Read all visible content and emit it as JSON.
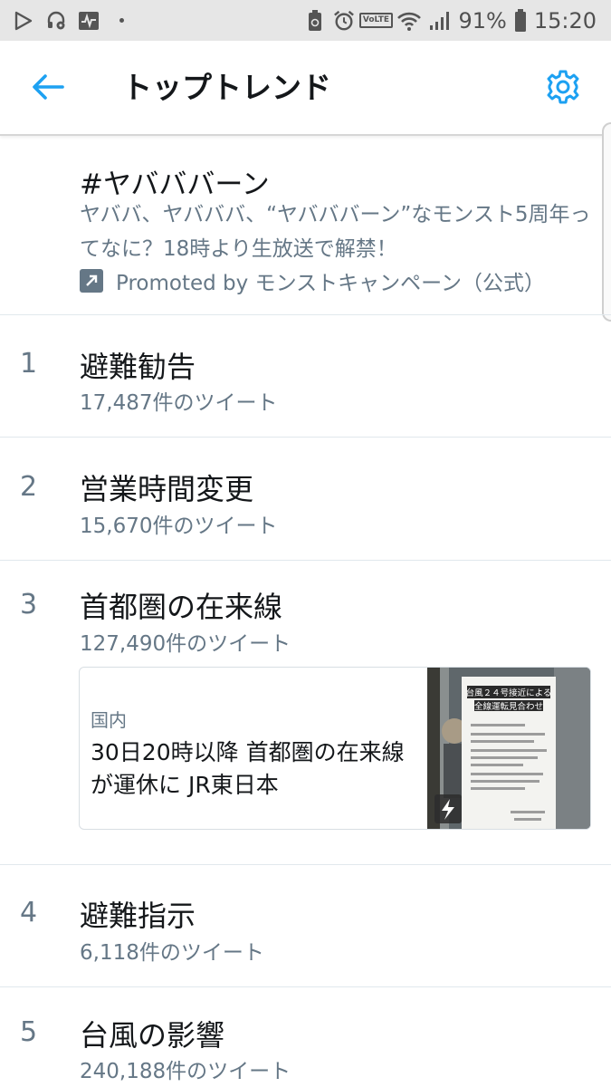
{
  "status_bar": {
    "battery": "91%",
    "time": "15:20",
    "network_badge": "VoLTE",
    "icons_left": [
      "play-store-icon",
      "headset-gear-icon",
      "activity-icon",
      "dot-icon"
    ],
    "icons_right": [
      "recycle-icon",
      "alarm-icon",
      "volte-icon",
      "wifi-icon",
      "signal-icon",
      "battery-icon"
    ]
  },
  "appbar": {
    "title": "トップトレンド",
    "back_icon": "arrow-left-icon",
    "settings_icon": "gear-icon",
    "accent_color": "#1da1f2"
  },
  "promoted": {
    "name": "#ヤバババーン",
    "description": "ヤババ、ヤバババ、“ヤバババーン”なモンスト5周年ってなに？18時より生放送で解禁！",
    "promoted_by": "Promoted by モンストキャンペーン（公式）",
    "icon": "promoted-arrow-icon"
  },
  "trends": [
    {
      "rank": "1",
      "name": "避難勧告",
      "count": "17,487件のツイート"
    },
    {
      "rank": "2",
      "name": "営業時間変更",
      "count": "15,670件のツイート"
    },
    {
      "rank": "3",
      "name": "首都圏の在来線",
      "count": "127,490件のツイート"
    },
    {
      "rank": "4",
      "name": "避難指示",
      "count": "6,118件のツイート"
    },
    {
      "rank": "5",
      "name": "台風の影響",
      "count": "240,188件のツイート"
    }
  ],
  "news_card": {
    "category": "国内",
    "headline": "30日20時以降 首都圏の在来線が運休に JR東日本",
    "image_sign_line1": "台風２４号接近による",
    "image_sign_line2": "全線運転見合わせ",
    "image_icon": "lightning-icon"
  }
}
